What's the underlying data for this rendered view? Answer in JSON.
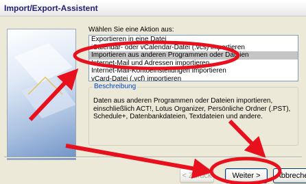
{
  "window": {
    "title": "Import/Export-Assistent"
  },
  "dialog": {
    "prompt": "Wählen Sie eine Aktion aus:",
    "actions": [
      "Exportieren in eine Datei",
      "iCalendar- oder vCalendar-Datei (.vcs) importieren",
      "Importieren aus anderen Programmen oder Dateien",
      "Internet-Mail und Adressen importieren",
      "Internet-Mail-Kontoeinstellungen importieren",
      "vCard-Datei (.vcf) importieren"
    ],
    "selected_index": 2,
    "description_legend": "Beschreibung",
    "description_text": "Daten aus anderen Programmen oder Dateien importieren, einschließlich ACT!, Lotus Organizer, Persönliche Ordner (.PST), Schedule+, Datenbankdateien, Textdateien und andere."
  },
  "buttons": {
    "back": "< Zurück",
    "next": "Weiter >",
    "cancel": "Abbrechen"
  },
  "annotation_color": "#e8101c"
}
